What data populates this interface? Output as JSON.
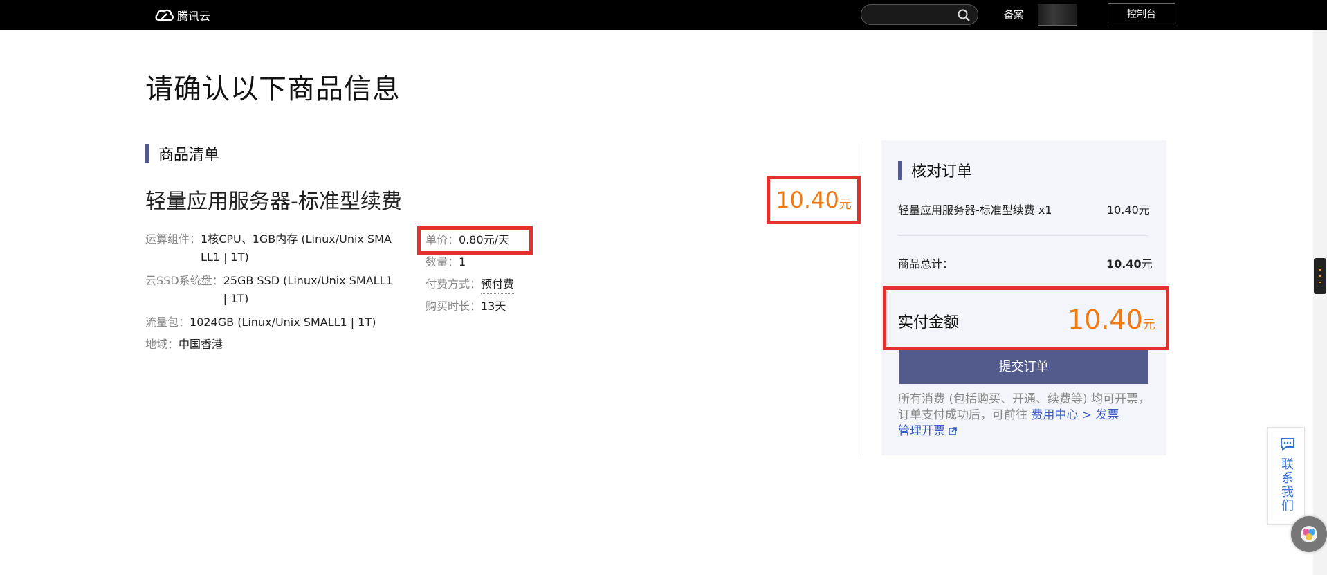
{
  "header": {
    "logo_text": "腾讯云",
    "search_placeholder": "",
    "nav_beian": "备案",
    "console_label": "控制台"
  },
  "page": {
    "title": "请确认以下商品信息"
  },
  "product_list": {
    "section_title": "商品清单",
    "product_name": "轻量应用服务器-标准型续费",
    "price_value": "10.40",
    "price_unit": "元",
    "specs": [
      {
        "label": "运算组件：",
        "value_line1": "1核CPU、1GB内存 (Linux/Unix SMA",
        "value_line2": "LL1 | 1T)"
      },
      {
        "label": "云SSD系统盘：",
        "value_line1": "25GB SSD (Linux/Unix SMALL1",
        "value_line2": "| 1T)"
      },
      {
        "label": "流量包：",
        "value": "1024GB (Linux/Unix SMALL1 | 1T)"
      },
      {
        "label": "地域：",
        "value": "中国香港"
      }
    ],
    "pricing": [
      {
        "label": "单价：",
        "value": "0.80元/天"
      },
      {
        "label": "数量：",
        "value": "1"
      },
      {
        "label": "付费方式：",
        "value": "预付费"
      },
      {
        "label": "购买时长：",
        "value": "13天"
      }
    ]
  },
  "order": {
    "section_title": "核对订单",
    "item_name": "轻量应用服务器-标准型续费 x1",
    "item_price": "10.40元",
    "total_label": "商品总计：",
    "total_value": "10.40",
    "total_unit": "元",
    "pay_label": "实付金额",
    "pay_value": "10.40",
    "pay_unit": "元",
    "submit_label": "提交订单",
    "note_text": "所有消费 (包括购买、开通、续费等) 均可开票，订单支付成功后，可前往 ",
    "note_link1": "费用中心 > 发票",
    "note_link2": "管理开票"
  },
  "float": {
    "contact_text": "联系我们"
  },
  "colors": {
    "accent": "#525b8c",
    "price": "#f07a12",
    "highlight": "#e53030",
    "link": "#3a5cc0"
  }
}
